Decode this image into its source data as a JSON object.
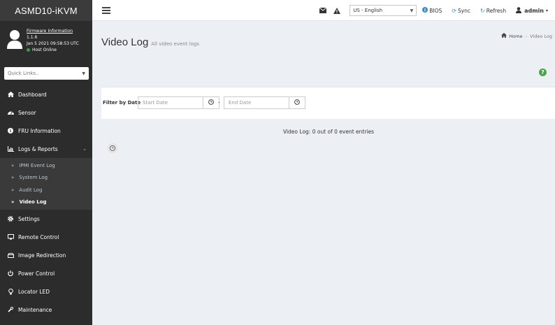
{
  "app": {
    "brand": "ASMD10-iKVM"
  },
  "header": {
    "language": "US - English",
    "links": {
      "bios": "BIOS",
      "sync": "Sync",
      "refresh": "Refresh"
    },
    "user": "admin"
  },
  "sidebar": {
    "firmware_title": "Firmware Information",
    "firmware_version": "1.1.6",
    "firmware_date": "Jan 5 2021 09:58:53 UTC",
    "host_status": "Host Online",
    "quick_links_placeholder": "Quick Links..",
    "items": [
      {
        "label": "Dashboard",
        "icon": "home-icon"
      },
      {
        "label": "Sensor",
        "icon": "gauge-icon"
      },
      {
        "label": "FRU Information",
        "icon": "info-icon"
      },
      {
        "label": "Logs & Reports",
        "icon": "chart-icon"
      },
      {
        "label": "Settings",
        "icon": "gear-icon"
      },
      {
        "label": "Remote Control",
        "icon": "monitor-icon"
      },
      {
        "label": "Image Redirection",
        "icon": "hdd-icon"
      },
      {
        "label": "Power Control",
        "icon": "power-icon"
      },
      {
        "label": "Locator LED",
        "icon": "lightbulb-icon"
      },
      {
        "label": "Maintenance",
        "icon": "wrench-icon"
      }
    ],
    "logs_submenu": [
      {
        "label": "IPMI Event Log"
      },
      {
        "label": "System Log"
      },
      {
        "label": "Audit Log"
      },
      {
        "label": "Video Log"
      }
    ]
  },
  "main": {
    "title": "Video Log",
    "subtitle": "All video event logs",
    "breadcrumb": {
      "home": "Home",
      "current": "Video Log"
    },
    "filter": {
      "label": "Filter by Date",
      "start_placeholder": "Start Date",
      "separator": "-",
      "end_placeholder": "End Date"
    },
    "entries_text": "Video Log: 0 out of 0 event entries"
  }
}
